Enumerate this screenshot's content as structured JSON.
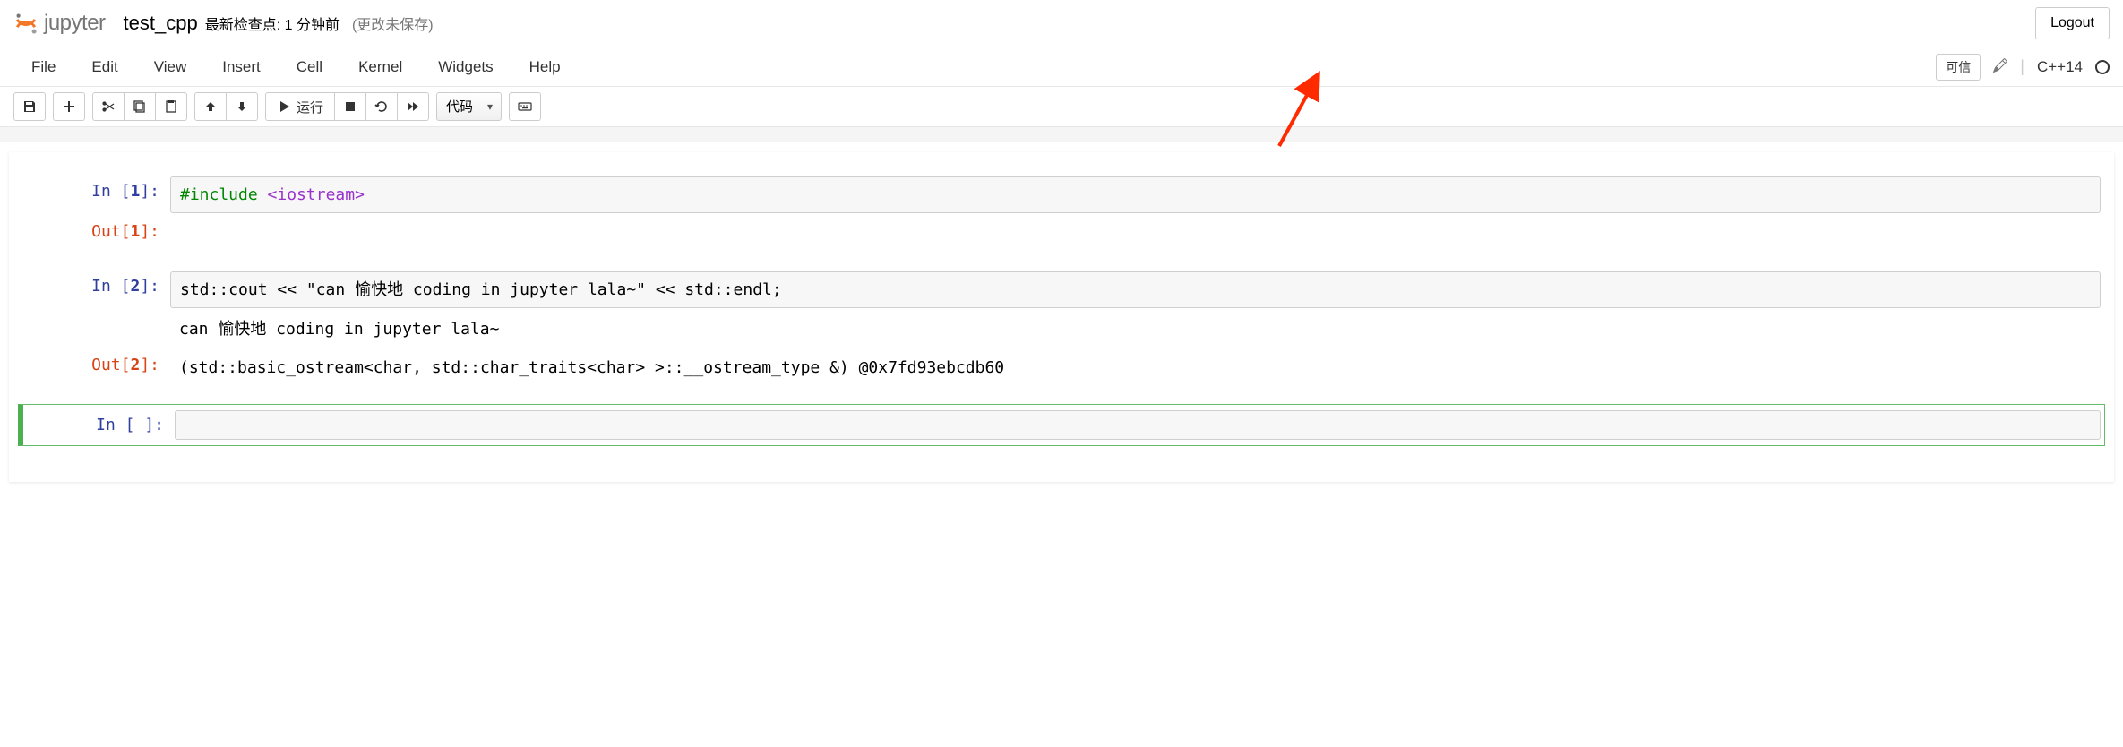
{
  "header": {
    "logo_text": "jupyter",
    "notebook_name": "test_cpp",
    "checkpoint": "最新检查点: 1 分钟前",
    "unsaved": "(更改未保存)",
    "logout": "Logout"
  },
  "menubar": {
    "items": [
      "File",
      "Edit",
      "View",
      "Insert",
      "Cell",
      "Kernel",
      "Widgets",
      "Help"
    ],
    "trusted": "可信",
    "kernel_name": "C++14"
  },
  "toolbar": {
    "run_label": "运行",
    "celltype": "代码"
  },
  "cells": [
    {
      "in_label": "In [",
      "in_num": "1",
      "in_close": "]:",
      "code_pre": "#include ",
      "code_inc": "<iostream>",
      "out_label": "Out[",
      "out_num": "1",
      "out_close": "]:",
      "out_text": ""
    },
    {
      "in_label": "In [",
      "in_num": "2",
      "in_close": "]:",
      "code": "std::cout << \"can 愉快地 coding in jupyter lala~\" << std::endl;",
      "stdout": "can 愉快地 coding in jupyter lala~",
      "out_label": "Out[",
      "out_num": "2",
      "out_close": "]:",
      "out_text": "(std::basic_ostream<char, std::char_traits<char> >::__ostream_type &) @0x7fd93ebcdb60"
    },
    {
      "in_label": "In [ ]:",
      "code": ""
    }
  ]
}
